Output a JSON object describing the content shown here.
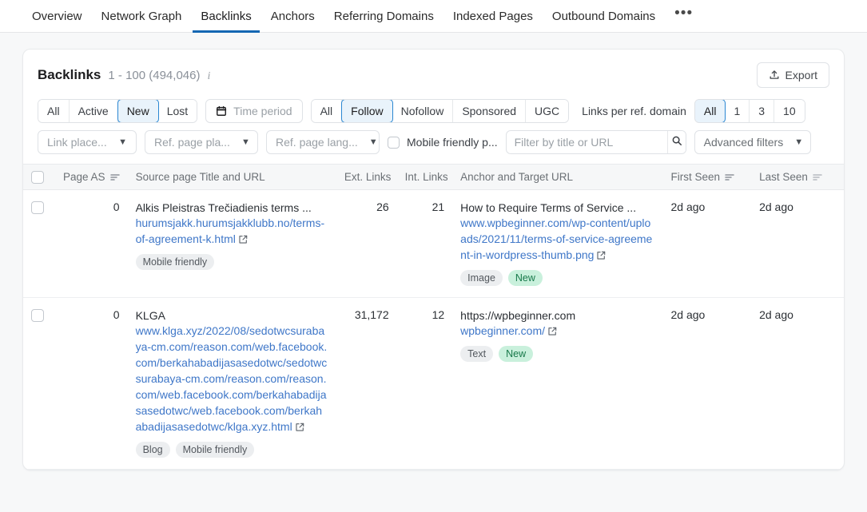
{
  "topnav": {
    "items": [
      {
        "label": "Overview",
        "active": false
      },
      {
        "label": "Network Graph",
        "active": false
      },
      {
        "label": "Backlinks",
        "active": true
      },
      {
        "label": "Anchors",
        "active": false
      },
      {
        "label": "Referring Domains",
        "active": false
      },
      {
        "label": "Indexed Pages",
        "active": false
      },
      {
        "label": "Outbound Domains",
        "active": false
      }
    ],
    "more_label": "•••"
  },
  "panel": {
    "title": "Backlinks",
    "count": "1 - 100 (494,046)",
    "info_icon": "info-icon",
    "export_label": "Export"
  },
  "filters": {
    "status_segment": {
      "name": "link-status-segment",
      "options": [
        "All",
        "Active",
        "New",
        "Lost"
      ],
      "selected": "New"
    },
    "time_period": {
      "label": "Time period",
      "icon": "calendar-icon"
    },
    "follow_segment": {
      "name": "follow-type-segment",
      "options": [
        "All",
        "Follow",
        "Nofollow",
        "Sponsored",
        "UGC"
      ],
      "selected": "Follow"
    },
    "links_per_domain": {
      "label": "Links per ref. domain",
      "options": [
        "All",
        "1",
        "3",
        "10"
      ],
      "selected": "All"
    },
    "link_placement": {
      "label": "Link place...",
      "icon": "chevron-down-icon"
    },
    "ref_page_placement": {
      "label": "Ref. page pla...",
      "icon": "chevron-down-icon"
    },
    "ref_page_language": {
      "label": "Ref. page lang...",
      "icon": "chevron-down-icon"
    },
    "mobile_friendly": {
      "label": "Mobile friendly p...",
      "checked": false
    },
    "search": {
      "placeholder": "Filter by title or URL",
      "value": "",
      "icon": "search-icon"
    },
    "advanced_filters": {
      "label": "Advanced filters",
      "icon": "chevron-down-icon"
    }
  },
  "table": {
    "columns": {
      "check": "",
      "page_as": "Page AS",
      "source": "Source page Title and URL",
      "ext_links": "Ext. Links",
      "int_links": "Int. Links",
      "anchor": "Anchor and Target URL",
      "first_seen": "First Seen",
      "last_seen": "Last Seen"
    },
    "rows": [
      {
        "page_as": "0",
        "source_title": "Alkis Pleistras Trečiadienis terms ...",
        "source_url": "hurumsjakk.hurumsjakklubb.no/terms-of-agreement-k.html",
        "source_badges": [
          {
            "text": "Mobile friendly",
            "style": "grey"
          }
        ],
        "ext_links": "26",
        "int_links": "21",
        "anchor_title": "How to Require Terms of Service ...",
        "target_url": "www.wpbeginner.com/wp-content/uploads/2021/11/terms-of-service-agreement-in-wordpress-thumb.png",
        "anchor_badges": [
          {
            "text": "Image",
            "style": "grey"
          },
          {
            "text": "New",
            "style": "green"
          }
        ],
        "first_seen": "2d ago",
        "last_seen": "2d ago"
      },
      {
        "page_as": "0",
        "source_title": "KLGA",
        "source_url": "www.klga.xyz/2022/08/sedotwcsurabaya-cm.com/reason.com/web.facebook.com/berkahabadijasasedotwc/sedotwcsurabaya-cm.com/reason.com/reason.com/web.facebook.com/berkahabadijasasedotwc/web.facebook.com/berkahabadijasasedotwc/klga.xyz.html",
        "source_badges": [
          {
            "text": "Blog",
            "style": "grey"
          },
          {
            "text": "Mobile friendly",
            "style": "grey"
          }
        ],
        "ext_links": "31,172",
        "int_links": "12",
        "anchor_title": "https://wpbeginner.com",
        "target_url": "wpbeginner.com/",
        "anchor_badges": [
          {
            "text": "Text",
            "style": "grey"
          },
          {
            "text": "New",
            "style": "green"
          }
        ],
        "first_seen": "2d ago",
        "last_seen": "2d ago"
      }
    ]
  },
  "colors": {
    "accent_blue": "#1467b3",
    "link_blue": "#3f77c8",
    "selected_bg": "#e9f3fb",
    "selected_border": "#2b87d2",
    "green_badge_bg": "#c9f0dc",
    "green_text": "#1f9a63"
  }
}
